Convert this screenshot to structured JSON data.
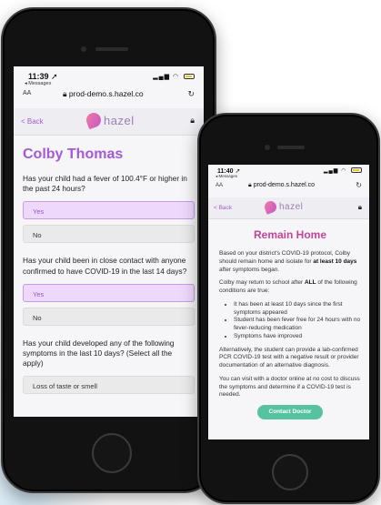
{
  "phone_left": {
    "status": {
      "time": "11:39",
      "back_app": "◂ Messages",
      "signal": "▂▄▆",
      "wifi": "◠"
    },
    "url_bar": {
      "aa": "AA",
      "url": "prod-demo.s.hazel.co"
    },
    "header": {
      "back": "< Back",
      "logo": "hazel"
    },
    "patient_name": "Colby Thomas",
    "questions": [
      {
        "text": "Has your child had a fever of 100.4°F or higher in the past 24 hours?",
        "options": [
          "Yes",
          "No"
        ]
      },
      {
        "text": "Has your child been in close contact with anyone confirmed to have COVID-19 in the last 14 days?",
        "options": [
          "Yes",
          "No"
        ]
      },
      {
        "text": "Has your child developed any of the following symptoms in the last 10 days? (Select all the apply)",
        "options": [
          "Loss of taste or smell"
        ]
      }
    ]
  },
  "phone_right": {
    "status": {
      "time": "11:40",
      "back_app": "◂ Messages",
      "signal": "▂▄▆",
      "wifi": "◠"
    },
    "url_bar": {
      "aa": "AA",
      "url": "prod-demo.s.hazel.co"
    },
    "header": {
      "back": "< Back",
      "logo": "hazel"
    },
    "title": "Remain Home",
    "p1_a": "Based on your district's COVID-19 protocol, Colby should remain home and isolate for ",
    "p1_b": "at least 10 days",
    "p1_c": " after symptoms began.",
    "p2_a": "Colby may return to school after ",
    "p2_b": "ALL",
    "p2_c": " of the following conditions are true:",
    "conditions": [
      "It has been at least 10 days since the first symptoms appeared",
      "Student has been fever free for 24 hours with no fever-reducing medication",
      "Symptoms have improved"
    ],
    "p3": "Alternatively, the student can provide a lab-confirmed PCR COVID-19 test with a negative result or provider documentation of an alternative diagnosis.",
    "p4": "You can visit with a doctor online at no cost to discuss the symptoms and determine if a COVID-19 test is needed.",
    "button": "Contact Doctor"
  },
  "colors": {
    "accent": "#a45ad4",
    "result_title": "#c2459a",
    "button": "#55c3a0"
  }
}
